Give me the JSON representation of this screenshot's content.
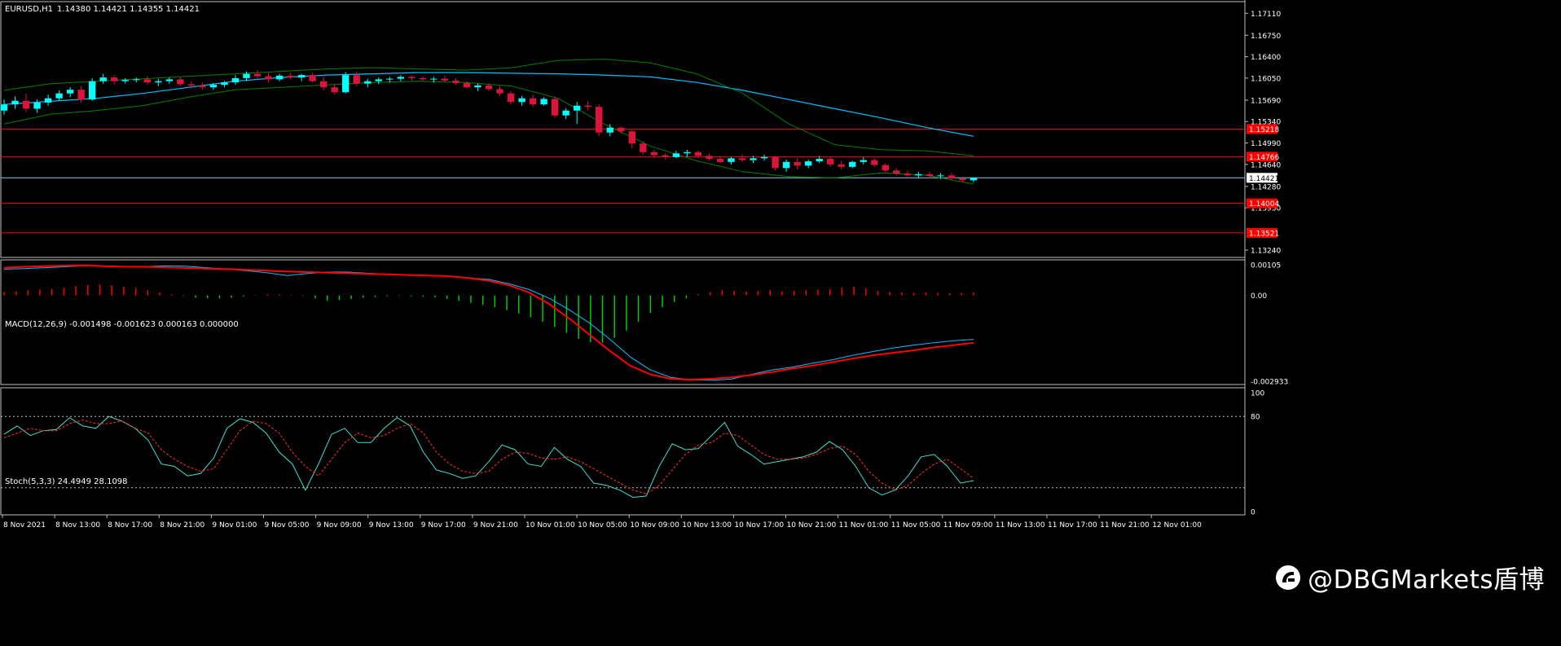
{
  "header": {
    "symbol_timeframe": "EURUSD,H1",
    "ohlc": "1.14380 1.14421 1.14355 1.14421"
  },
  "colors": {
    "background": "#000000",
    "bull": "#00FFFF",
    "bear": "#DC143C",
    "axis": "#C0C0C0",
    "grid": "#C0C0C0",
    "bands": "#008000",
    "ma": "#00BFFF",
    "hline": "#FF0000",
    "current_price_line": "#87CEEB",
    "macd_main": "#00BFFF",
    "macd_signal": "#FF0000",
    "hist_pos": "#FF0000",
    "hist_neg": "#00CC00",
    "stoch_main": "#40E0D0",
    "stoch_signal": "#FF3030"
  },
  "price_axis": {
    "min": 1.1312,
    "max": 1.173,
    "ticks": [
      "1.17110",
      "1.16750",
      "1.16400",
      "1.16050",
      "1.15690",
      "1.15340",
      "1.14990",
      "1.14640",
      "1.14280",
      "1.13930",
      "1.13240"
    ],
    "current": "1.14421",
    "level_labels": [
      "1.15218",
      "1.14766",
      "1.14004",
      "1.13521"
    ]
  },
  "macd_axis": {
    "title": "MACD(12,26,9) -0.001498 -0.001623 0.000163 0.000000",
    "ticks": [
      "0.00105",
      "0.00",
      "-0.002933"
    ],
    "min": -0.002933,
    "max": 0.00105
  },
  "stoch_axis": {
    "title": "Stoch(5,3,3) 24.4949 28.1098",
    "ticks": [
      "100",
      "80",
      "0"
    ],
    "levels": [
      80,
      20
    ]
  },
  "time_labels": [
    "8 Nov 2021",
    "8 Nov 13:00",
    "8 Nov 17:00",
    "8 Nov 21:00",
    "9 Nov 01:00",
    "9 Nov 05:00",
    "9 Nov 09:00",
    "9 Nov 13:00",
    "9 Nov 17:00",
    "9 Nov 21:00",
    "10 Nov 01:00",
    "10 Nov 05:00",
    "10 Nov 09:00",
    "10 Nov 13:00",
    "10 Nov 17:00",
    "10 Nov 21:00",
    "11 Nov 01:00",
    "11 Nov 05:00",
    "11 Nov 09:00",
    "11 Nov 13:00",
    "11 Nov 17:00",
    "11 Nov 21:00",
    "12 Nov 01:00"
  ],
  "watermark": "@DBGMarkets盾博",
  "chart_data": [
    {
      "type": "candlestick",
      "title": "EURUSD,H1",
      "x_start": "8 Nov 2021 09:00",
      "x_interval": "1 hour",
      "ylim": [
        1.1312,
        1.173
      ],
      "ohlc": [
        [
          1.1552,
          1.157,
          1.1545,
          1.1562
        ],
        [
          1.1562,
          1.1575,
          1.1555,
          1.1568
        ],
        [
          1.1568,
          1.158,
          1.155,
          1.1555
        ],
        [
          1.1555,
          1.157,
          1.1548,
          1.1565
        ],
        [
          1.1565,
          1.1578,
          1.156,
          1.1572
        ],
        [
          1.1572,
          1.1585,
          1.1568,
          1.158
        ],
        [
          1.158,
          1.159,
          1.1574,
          1.1586
        ],
        [
          1.1586,
          1.1592,
          1.1565,
          1.157
        ],
        [
          1.157,
          1.1605,
          1.1568,
          1.16
        ],
        [
          1.16,
          1.1612,
          1.1596,
          1.1606
        ],
        [
          1.1606,
          1.161,
          1.1595,
          1.16
        ],
        [
          1.16,
          1.1605,
          1.1596,
          1.1602
        ],
        [
          1.1602,
          1.1606,
          1.1598,
          1.1603
        ],
        [
          1.1603,
          1.1608,
          1.1595,
          1.1598
        ],
        [
          1.1598,
          1.1604,
          1.1592,
          1.16
        ],
        [
          1.16,
          1.1606,
          1.1596,
          1.1603
        ],
        [
          1.1603,
          1.1606,
          1.1592,
          1.1595
        ],
        [
          1.1595,
          1.16,
          1.1588,
          1.1593
        ],
        [
          1.1593,
          1.1598,
          1.1586,
          1.159
        ],
        [
          1.159,
          1.1597,
          1.1586,
          1.1594
        ],
        [
          1.1594,
          1.16,
          1.159,
          1.1598
        ],
        [
          1.1598,
          1.161,
          1.1594,
          1.1605
        ],
        [
          1.1605,
          1.1616,
          1.16,
          1.1612
        ],
        [
          1.1612,
          1.1618,
          1.1604,
          1.1608
        ],
        [
          1.1608,
          1.1614,
          1.1598,
          1.1603
        ],
        [
          1.1603,
          1.1612,
          1.16,
          1.1609
        ],
        [
          1.1609,
          1.1614,
          1.1603,
          1.1606
        ],
        [
          1.1606,
          1.1612,
          1.16,
          1.161
        ],
        [
          1.161,
          1.1614,
          1.1598,
          1.16
        ],
        [
          1.16,
          1.1608,
          1.1585,
          1.159
        ],
        [
          1.159,
          1.1596,
          1.1578,
          1.1582
        ],
        [
          1.1582,
          1.1615,
          1.158,
          1.161
        ],
        [
          1.161,
          1.1616,
          1.1592,
          1.1596
        ],
        [
          1.1596,
          1.1604,
          1.159,
          1.16
        ],
        [
          1.16,
          1.1606,
          1.1595,
          1.1603
        ],
        [
          1.1603,
          1.1607,
          1.1598,
          1.1604
        ],
        [
          1.1604,
          1.161,
          1.16,
          1.1607
        ],
        [
          1.1607,
          1.161,
          1.1601,
          1.1605
        ],
        [
          1.1605,
          1.1608,
          1.16,
          1.1603
        ],
        [
          1.1603,
          1.1607,
          1.1598,
          1.1604
        ],
        [
          1.1604,
          1.1609,
          1.1598,
          1.1601
        ],
        [
          1.1601,
          1.1605,
          1.1594,
          1.1597
        ],
        [
          1.1597,
          1.16,
          1.1588,
          1.159
        ],
        [
          1.159,
          1.1596,
          1.1584,
          1.1593
        ],
        [
          1.1593,
          1.1597,
          1.1583,
          1.1587
        ],
        [
          1.1587,
          1.1592,
          1.1576,
          1.158
        ],
        [
          1.158,
          1.1584,
          1.1562,
          1.1566
        ],
        [
          1.1566,
          1.1576,
          1.156,
          1.1572
        ],
        [
          1.1572,
          1.1578,
          1.1558,
          1.1562
        ],
        [
          1.1562,
          1.1574,
          1.156,
          1.1571
        ],
        [
          1.1571,
          1.1575,
          1.154,
          1.1544
        ],
        [
          1.1544,
          1.1556,
          1.1538,
          1.1552
        ],
        [
          1.1552,
          1.1566,
          1.153,
          1.156
        ],
        [
          1.156,
          1.1568,
          1.1552,
          1.1558
        ],
        [
          1.1558,
          1.1562,
          1.151,
          1.1516
        ],
        [
          1.1516,
          1.153,
          1.151,
          1.1524
        ],
        [
          1.1524,
          1.1526,
          1.1514,
          1.1518
        ],
        [
          1.1518,
          1.152,
          1.149,
          1.1498
        ],
        [
          1.1498,
          1.1502,
          1.148,
          1.1484
        ],
        [
          1.1484,
          1.1488,
          1.1474,
          1.1479
        ],
        [
          1.1479,
          1.1482,
          1.1472,
          1.1476
        ],
        [
          1.1476,
          1.1486,
          1.1474,
          1.1482
        ],
        [
          1.1482,
          1.1488,
          1.1476,
          1.1484
        ],
        [
          1.1484,
          1.1486,
          1.1474,
          1.1478
        ],
        [
          1.1478,
          1.1482,
          1.147,
          1.1473
        ],
        [
          1.1473,
          1.1478,
          1.1466,
          1.1468
        ],
        [
          1.1468,
          1.1476,
          1.1464,
          1.1474
        ],
        [
          1.1474,
          1.148,
          1.1468,
          1.1471
        ],
        [
          1.1471,
          1.1478,
          1.1466,
          1.1474
        ],
        [
          1.1474,
          1.148,
          1.147,
          1.1476
        ],
        [
          1.1476,
          1.1478,
          1.1454,
          1.1458
        ],
        [
          1.1458,
          1.1472,
          1.1452,
          1.1468
        ],
        [
          1.1468,
          1.1474,
          1.1456,
          1.1462
        ],
        [
          1.1462,
          1.1472,
          1.1458,
          1.1469
        ],
        [
          1.1469,
          1.1478,
          1.1466,
          1.1473
        ],
        [
          1.1473,
          1.1476,
          1.146,
          1.1464
        ],
        [
          1.1464,
          1.147,
          1.1456,
          1.146
        ],
        [
          1.146,
          1.147,
          1.1458,
          1.1468
        ],
        [
          1.1468,
          1.1476,
          1.1464,
          1.1471
        ],
        [
          1.1471,
          1.1474,
          1.146,
          1.1463
        ],
        [
          1.1463,
          1.1466,
          1.145,
          1.1454
        ],
        [
          1.1454,
          1.1458,
          1.1446,
          1.1449
        ],
        [
          1.1449,
          1.1454,
          1.1444,
          1.1446
        ],
        [
          1.1446,
          1.1452,
          1.1442,
          1.1448
        ],
        [
          1.1448,
          1.1452,
          1.1442,
          1.1445
        ],
        [
          1.1445,
          1.145,
          1.144,
          1.1446
        ],
        [
          1.1446,
          1.145,
          1.1438,
          1.1441
        ],
        [
          1.1441,
          1.1444,
          1.1434,
          1.1438
        ],
        [
          1.1438,
          1.1442,
          1.1435,
          1.1442
        ]
      ],
      "overlays": [
        {
          "kind": "ma",
          "values": [
            1.1562,
            1.1567,
            1.1572,
            1.158,
            1.159,
            1.16,
            1.1606,
            1.161,
            1.1612,
            1.1614,
            1.1614,
            1.1613,
            1.1612,
            1.161,
            1.1607,
            1.1598,
            1.1585,
            1.157,
            1.1555,
            1.154,
            1.1524,
            1.151
          ]
        },
        {
          "kind": "band_upper",
          "values": [
            1.1585,
            1.1596,
            1.16,
            1.1604,
            1.1608,
            1.1612,
            1.1616,
            1.162,
            1.1622,
            1.162,
            1.1618,
            1.1622,
            1.1634,
            1.1636,
            1.163,
            1.1612,
            1.158,
            1.153,
            1.1496,
            1.1488,
            1.1486,
            1.1478
          ]
        },
        {
          "kind": "band_lower",
          "values": [
            1.153,
            1.1546,
            1.1552,
            1.156,
            1.1574,
            1.1586,
            1.159,
            1.1594,
            1.1598,
            1.16,
            1.1598,
            1.1592,
            1.1572,
            1.153,
            1.1494,
            1.147,
            1.1452,
            1.1444,
            1.1442,
            1.145,
            1.1446,
            1.1432
          ]
        }
      ],
      "levels": [
        1.15218,
        1.14766,
        1.14004,
        1.13521
      ],
      "current": 1.14421
    },
    {
      "type": "line",
      "title": "MACD(12,26,9) -0.001498 -0.001623 0.000163 0.000000",
      "ylim": [
        -0.002933,
        0.00105
      ],
      "series": [
        {
          "values": [
            0.0009,
            0.00092,
            0.00095,
            0.00098,
            0.00102,
            0.001,
            0.00097,
            0.00099,
            0.00101,
            0.001,
            0.00095,
            0.0009,
            0.00085,
            0.00078,
            0.00068,
            0.00075,
            0.0008,
            0.0008,
            0.00076,
            0.00072,
            0.0007,
            0.00068,
            0.00065,
            0.0006,
            0.00055,
            0.0004,
            0.0002,
            -0.0001,
            -0.0005,
            -0.00095,
            -0.0015,
            -0.0021,
            -0.00255,
            -0.0028,
            -0.00288,
            -0.0029,
            -0.00286,
            -0.0027,
            -0.00255,
            -0.00245,
            -0.00232,
            -0.0022,
            -0.00205,
            -0.00192,
            -0.0018,
            -0.0017,
            -0.00162,
            -0.00155,
            -0.0015
          ]
        },
        {
          "values": [
            0.00095,
            0.00098,
            0.001,
            0.00102,
            0.00103,
            0.001,
            0.00098,
            0.00098,
            0.00096,
            0.00094,
            0.00092,
            0.0009,
            0.00088,
            0.00085,
            0.00082,
            0.0008,
            0.00078,
            0.00076,
            0.00074,
            0.00072,
            0.0007,
            0.00068,
            0.00066,
            0.0006,
            0.0005,
            0.00035,
            0.0001,
            -0.0003,
            -0.0008,
            -0.00135,
            -0.0019,
            -0.0024,
            -0.0027,
            -0.00285,
            -0.00288,
            -0.00285,
            -0.0028,
            -0.00272,
            -0.00262,
            -0.0025,
            -0.0024,
            -0.00228,
            -0.00216,
            -0.00205,
            -0.00196,
            -0.00188,
            -0.00178,
            -0.0017,
            -0.00162
          ]
        }
      ],
      "histogram": [
        0.00012,
        0.00015,
        0.00018,
        0.0002,
        0.00022,
        0.00026,
        0.00032,
        0.00036,
        0.00038,
        0.00035,
        0.0003,
        0.00025,
        0.00018,
        0.0001,
        4e-05,
        -2e-05,
        -8e-05,
        -0.0001,
        -0.0001,
        -8e-05,
        -4e-05,
        2e-05,
        4e-05,
        4e-05,
        2e-05,
        -2e-05,
        -0.0001,
        -0.00018,
        -0.00016,
        -0.00012,
        -8e-05,
        -5e-05,
        -3e-05,
        -2e-05,
        -3e-05,
        -4e-05,
        -6e-05,
        -0.00012,
        -0.00018,
        -0.00025,
        -0.00032,
        -0.0004,
        -0.0005,
        -0.00062,
        -0.00075,
        -0.0009,
        -0.00108,
        -0.00128,
        -0.00148,
        -0.0016,
        -0.00162,
        -0.00145,
        -0.0012,
        -0.0009,
        -0.0006,
        -0.0004,
        -0.00022,
        -0.0001,
        5e-05,
        0.00012,
        0.00018,
        0.00016,
        0.00014,
        0.00016,
        0.00018,
        0.00014,
        0.00016,
        0.00018,
        0.0002,
        0.00022,
        0.00026,
        0.0003,
        0.00024,
        0.00016,
        0.00012,
        0.0001,
        9e-05,
        0.0001,
        9e-05,
        8e-05,
        9e-05,
        0.0001
      ]
    },
    {
      "type": "line",
      "title": "Stoch(5,3,3) 24.4949 28.1098",
      "ylim": [
        0,
        100
      ],
      "levels": [
        80,
        20
      ],
      "series": [
        {
          "values": [
            65,
            72,
            64,
            68,
            69,
            79,
            72,
            70,
            80,
            76,
            70,
            60,
            40,
            38,
            30,
            32,
            45,
            70,
            78,
            75,
            66,
            50,
            40,
            18,
            40,
            65,
            70,
            58,
            58,
            70,
            79,
            72,
            50,
            35,
            32,
            28,
            30,
            42,
            56,
            52,
            40,
            38,
            54,
            44,
            38,
            24,
            22,
            18,
            12,
            13,
            38,
            57,
            52,
            53,
            64,
            75,
            55,
            48,
            40,
            42,
            44,
            46,
            50,
            59,
            52,
            38,
            20,
            14,
            18,
            30,
            46,
            48,
            38,
            24,
            26
          ]
        },
        {
          "values": [
            62,
            66,
            70,
            68,
            68,
            74,
            77,
            74,
            74,
            76,
            70,
            66,
            52,
            44,
            38,
            34,
            36,
            52,
            68,
            76,
            74,
            66,
            50,
            38,
            30,
            44,
            58,
            66,
            62,
            64,
            70,
            74,
            66,
            50,
            40,
            34,
            32,
            34,
            44,
            50,
            49,
            45,
            44,
            46,
            42,
            36,
            30,
            24,
            18,
            15,
            22,
            35,
            48,
            56,
            58,
            66,
            64,
            56,
            48,
            44,
            44,
            45,
            48,
            53,
            55,
            48,
            34,
            24,
            18,
            22,
            32,
            40,
            44,
            36,
            28
          ]
        }
      ]
    }
  ]
}
